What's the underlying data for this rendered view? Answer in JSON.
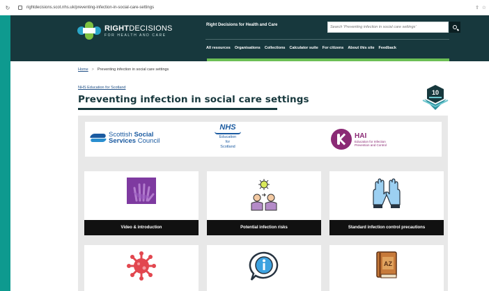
{
  "browser": {
    "url": "rightdecisions.scot.nhs.uk/preventing-infection-in-social-care-settings"
  },
  "header": {
    "logo_primary": "RIGHT",
    "logo_secondary": "DECISIONS",
    "logo_tagline": "FOR HEALTH AND CARE",
    "site_title": "Right Decisions for Health and Care",
    "search_placeholder": "Search 'Preventing infection in social care settings'",
    "nav": [
      "All resources",
      "Organisations",
      "Collections",
      "Calculator suite",
      "For citizens",
      "About this site",
      "Feedback"
    ]
  },
  "breadcrumb": {
    "home": "Home",
    "separator": ">",
    "current": "Preventing infection in social care settings"
  },
  "org_link": "NHS Education for Scotland",
  "page_title": "Preventing infection in social care settings",
  "badge": {
    "number": "10"
  },
  "partner_logos": {
    "ssc_line1_a": "Scottish ",
    "ssc_line1_b": "Social",
    "ssc_line2_a": "Services",
    "ssc_line2_b": " Council",
    "nhs": "NHS",
    "nhs_sub1": "Education",
    "nhs_sub2": "for",
    "nhs_sub3": "Scotland",
    "hai": "HAI",
    "hai_sub1": "Education for Infection",
    "hai_sub2": "Prevention and Control"
  },
  "cards": [
    {
      "label": "Video & introduction",
      "icon": "hand-icon"
    },
    {
      "label": "Potential infection risks",
      "icon": "people-virus-icon"
    },
    {
      "label": "Standard infection control precautions",
      "icon": "gloves-icon"
    },
    {
      "label": "",
      "icon": "virus-icon"
    },
    {
      "label": "",
      "icon": "info-bubble-icon"
    },
    {
      "label": "",
      "icon": "az-book-icon"
    }
  ],
  "colors": {
    "header_bg": "#17383d",
    "accent_green": "#6cbf55",
    "outer_bg": "#0e9a8f"
  }
}
